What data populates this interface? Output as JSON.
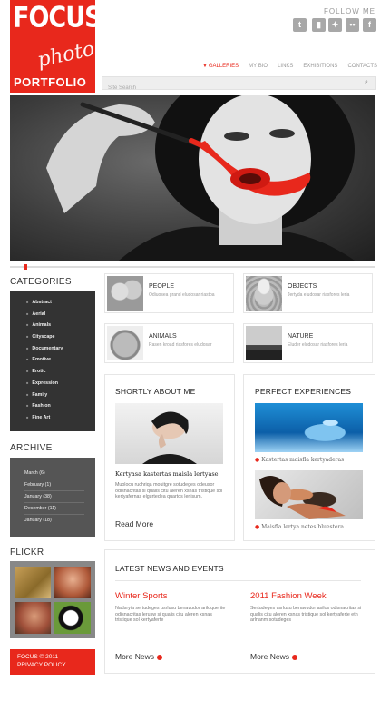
{
  "logo": {
    "line1": "FOCUS",
    "line2": "photo",
    "line3": "PORTFOLIO"
  },
  "header": {
    "follow_label": "FOLLOW ME",
    "social": [
      "twitter-icon",
      "book-icon",
      "share-icon",
      "flickr-icon",
      "facebook-icon"
    ],
    "nav": [
      "GALLERIES",
      "MY BIO",
      "LINKS",
      "EXHIBITIONS",
      "CONTACTS"
    ],
    "search_placeholder": "Site Search"
  },
  "sidebar": {
    "categories_title": "CATEGORIES",
    "categories": [
      "Abstract",
      "Aerial",
      "Animals",
      "Cityscape",
      "Documentary",
      "Emotive",
      "Erotic",
      "Expression",
      "Family",
      "Fashion",
      "Fine Art"
    ],
    "archive_title": "ARCHIVE",
    "archive": [
      "March (6)",
      "February (1)",
      "January (38)",
      "December (11)",
      "January (18)"
    ],
    "flickr_title": "FLICKR",
    "footer_line1": "FOCUS © 2011",
    "footer_line2": "PRIVACY POLICY"
  },
  "tiles": [
    {
      "title": "PEOPLE",
      "desc": "Odiuosea grand eludosar riastoa"
    },
    {
      "title": "OBJECTS",
      "desc": "Jertyda eludosar riasfores leria"
    },
    {
      "title": "ANIMALS",
      "desc": "Rasen kroad riasfores eludosar"
    },
    {
      "title": "NATURE",
      "desc": "Eluder eludosar riasfores leria"
    }
  ],
  "about": {
    "title": "SHORTLY ABOUT ME",
    "headline": "Kertyasa kastertas maisla lertyase",
    "text": "Muolocu ruchriqa mouitgre sotudeges odeusor odisnacritas si qualis citu aleren xsnas tristique sol kertyafernas elgurtedea quartos lerlisum.",
    "more": "Read More"
  },
  "experiences": {
    "title": "PERFECT EXPERIENCES",
    "caption1": "Kastertas maisfla kertyaderas",
    "caption2": "Maisfla lertya netes bluestera"
  },
  "news": {
    "title": "LATEST NEWS AND EVENTS",
    "items": [
      {
        "title": "Winter Sports",
        "text": "Nadsryia sertudeges usrlusu benavudor ariloquerite odisnacritas lerusw si qualis citu aleren xsnas tristique sol kertyaferte",
        "more": "More News"
      },
      {
        "title": "2011 Fashion Week",
        "text": "Sertudeges usrlusu benavudor asilos odisnacritas si qualis citu aleren xsnas tristique sol kertyaferte etn arlnanm sotudeges",
        "more": "More News"
      }
    ]
  },
  "colors": {
    "accent": "#e8281c",
    "dark": "#333333",
    "mid": "#555555"
  }
}
